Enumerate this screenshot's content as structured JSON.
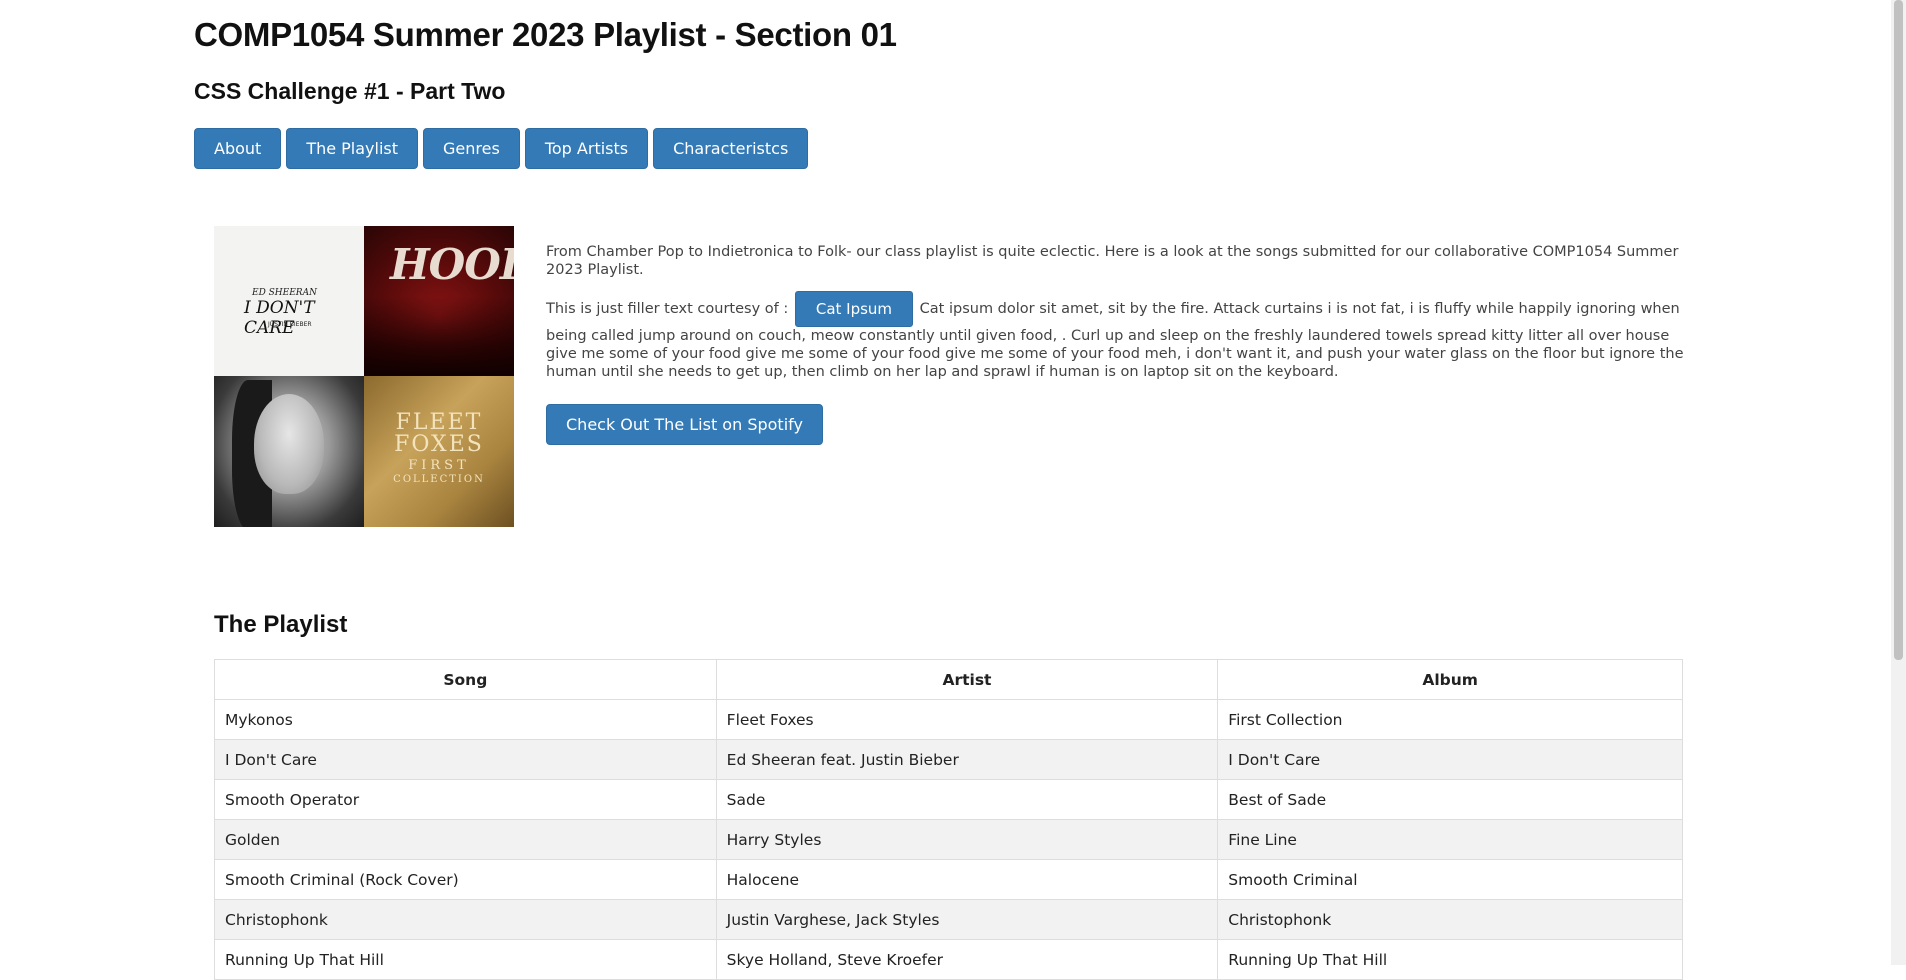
{
  "header": {
    "title": "COMP1054 Summer 2023 Playlist - Section 01",
    "subtitle": "CSS Challenge #1 - Part Two"
  },
  "nav": {
    "items": [
      {
        "label": "About"
      },
      {
        "label": "The Playlist"
      },
      {
        "label": "Genres"
      },
      {
        "label": "Top Artists"
      },
      {
        "label": "Characteristcs"
      }
    ]
  },
  "covers": [
    {
      "icon": "album-cover-i-dont-care",
      "lines": [
        "ED SHEERAN",
        "I DON'T CARE",
        "JUSTIN BIEBER"
      ]
    },
    {
      "icon": "album-cover-hood",
      "lines": [
        "HOOD"
      ]
    },
    {
      "icon": "album-cover-sade-portrait",
      "lines": []
    },
    {
      "icon": "album-cover-fleet-foxes",
      "lines": [
        "FLEET FOXES",
        "FIRST",
        "COLLECTION"
      ]
    }
  ],
  "intro": {
    "paragraph1": "From Chamber Pop to Indietronica to Folk- our class playlist is quite eclectic. Here is a look at the songs submitted for our collaborative COMP1054 Summer 2023 Playlist.",
    "filler_prefix": "This is just filler text courtesy of :",
    "cat_ipsum_label": "Cat Ipsum",
    "filler_text": "Cat ipsum dolor sit amet, sit by the fire. Attack curtains i is not fat, i is fluffy while happily ignoring when being called jump around on couch, meow constantly until given food, . Curl up and sleep on the freshly laundered towels spread kitty litter all over house give me some of your food give me some of your food give me some of your food meh, i don't want it, and push your water glass on the floor but ignore the human until she needs to get up, then climb on her lap and sprawl if human is on laptop sit on the keyboard.",
    "spotify_label": "Check Out The List on Spotify"
  },
  "playlist": {
    "heading": "The Playlist",
    "columns": [
      "Song",
      "Artist",
      "Album"
    ],
    "rows": [
      [
        "Mykonos",
        "Fleet Foxes",
        "First Collection"
      ],
      [
        "I Don't Care",
        "Ed Sheeran feat. Justin Bieber",
        "I Don't Care"
      ],
      [
        "Smooth Operator",
        "Sade",
        "Best of Sade"
      ],
      [
        "Golden",
        "Harry Styles",
        "Fine Line"
      ],
      [
        "Smooth Criminal (Rock Cover)",
        "Halocene",
        "Smooth Criminal"
      ],
      [
        "Christophonk",
        "Justin Varghese, Jack Styles",
        "Christophonk"
      ],
      [
        "Running Up That Hill",
        "Skye Holland, Steve Kroefer",
        "Running Up That Hill"
      ]
    ]
  },
  "colors": {
    "button_bg": "#337ab7",
    "button_text": "#ffffff",
    "row_alt": "#f2f2f2",
    "border": "#dddddd"
  }
}
